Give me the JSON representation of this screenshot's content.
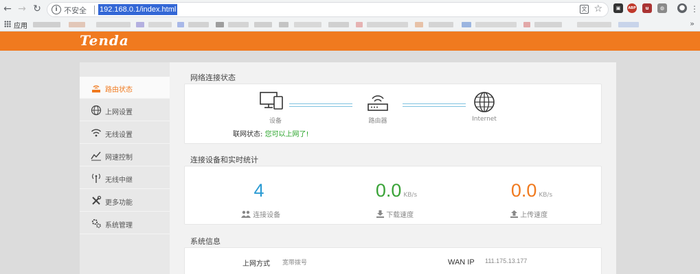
{
  "browser": {
    "insecure_label": "不安全",
    "url": "192.168.0.1/index.html",
    "apps_label": "应用",
    "bookmarks_more": "»",
    "ext_abp": "ABP"
  },
  "brand": {
    "logo": "Tenda",
    "accent": "#f07a1f"
  },
  "sidebar": {
    "items": [
      {
        "label": "路由状态",
        "icon": "router-status-icon"
      },
      {
        "label": "上网设置",
        "icon": "globe-icon"
      },
      {
        "label": "无线设置",
        "icon": "wifi-icon"
      },
      {
        "label": "网速控制",
        "icon": "speed-chart-icon"
      },
      {
        "label": "无线中继",
        "icon": "repeater-icon"
      },
      {
        "label": "更多功能",
        "icon": "tools-icon"
      },
      {
        "label": "系统管理",
        "icon": "gears-icon"
      }
    ]
  },
  "network_status": {
    "title": "网络连接状态",
    "nodes": [
      {
        "label": "设备",
        "icon": "device-icon"
      },
      {
        "label": "路由器",
        "icon": "router-icon"
      },
      {
        "label": "Internet",
        "icon": "internet-globe-icon"
      }
    ],
    "status_label": "联网状态:",
    "status_value": "您可以上网了!"
  },
  "realtime": {
    "title": "连接设备和实时统计",
    "devices": {
      "value": "4",
      "label": "连接设备",
      "color": "#2b9bd3"
    },
    "download": {
      "value": "0.0",
      "unit": "KB/s",
      "label": "下载速度",
      "color": "#3aa338"
    },
    "upload": {
      "value": "0.0",
      "unit": "KB/s",
      "label": "上传速度",
      "color": "#f07a1f"
    }
  },
  "system_info": {
    "title": "系统信息",
    "connection_type_label": "上网方式",
    "connection_type_value": "宽带拨号",
    "wan_ip_label": "WAN IP",
    "wan_ip_value": "111.175.13.177"
  }
}
